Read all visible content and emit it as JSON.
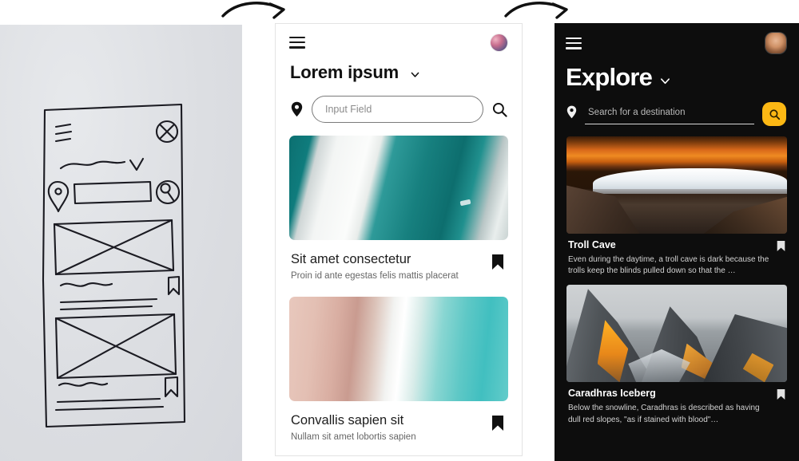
{
  "arrows": [
    {
      "name": "arrow-sketch-to-light"
    },
    {
      "name": "arrow-light-to-dark"
    }
  ],
  "sketch_panel": {
    "label": "hand-drawn wireframe sketch on paper",
    "elements": [
      "hamburger-menu-lines",
      "circle-x-avatar",
      "squiggle-title",
      "chevron-down",
      "location-pin",
      "input-field-rectangle",
      "search-magnifier-circle",
      "image-placeholder-with-x",
      "bookmark-flag",
      "title-squiggle",
      "text-lines"
    ]
  },
  "light_panel": {
    "menu_icon": "hamburger-icon",
    "avatar": "user-avatar",
    "title": "Lorem ipsum",
    "title_chevron": "chevron-down-icon",
    "pin_icon": "location-pin-icon",
    "search": {
      "value": "",
      "placeholder": "Input Field"
    },
    "search_icon": "search-icon",
    "cards": [
      {
        "image": "aerial-glacier-teal-ice",
        "title": "Sit amet consectetur",
        "subtitle": "Proin id ante egestas felis mattis placerat",
        "bookmark": "bookmark-icon"
      },
      {
        "image": "aerial-beach-turquoise-water",
        "title": "Convallis sapien sit",
        "subtitle": "Nullam sit amet lobortis sapien",
        "bookmark": "bookmark-icon"
      }
    ]
  },
  "dark_panel": {
    "menu_icon": "hamburger-icon",
    "avatar": "user-avatar",
    "title": "Explore",
    "title_chevron": "chevron-down-icon",
    "pin_icon": "location-pin-icon",
    "search": {
      "value": "",
      "placeholder": "Search for a destination"
    },
    "search_button_icon": "search-icon",
    "accent_color": "#FCB814",
    "background_color": "#0D0D0D",
    "cards": [
      {
        "image": "desert-arch-sunrise",
        "title": "Troll Cave",
        "subtitle": "Even during the daytime, a troll cave is dark because the trolls keep the blinds pulled down so that the …",
        "bookmark": "bookmark-icon"
      },
      {
        "image": "mountain-peaks-alpenglow",
        "title": "Caradhras Iceberg",
        "subtitle": "Below the snowline, Caradhras is described as having dull red slopes, \"as if stained with blood\"…",
        "bookmark": "bookmark-icon"
      }
    ]
  }
}
